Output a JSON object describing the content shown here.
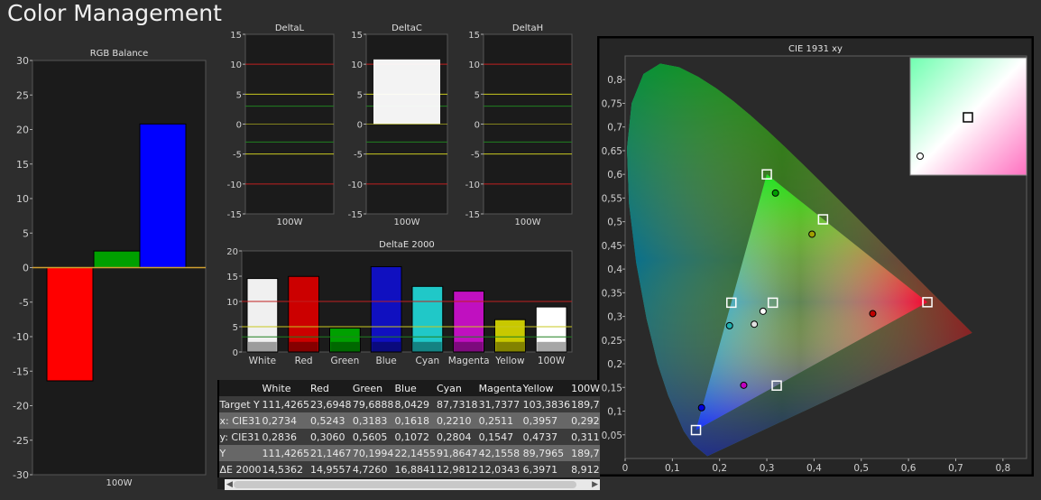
{
  "page": {
    "title": "Color Management"
  },
  "colors": {
    "red": "#ff0000",
    "green": "#00a000",
    "blue": "#0000ff",
    "white": "#f0f0f0",
    "cyan": "#20c8c8",
    "magenta": "#c000c0",
    "yellow": "#c8c800",
    "gray": "#888888"
  },
  "chart_data": [
    {
      "type": "bar",
      "title": "RGB Balance",
      "categories": [
        "100W"
      ],
      "series": [
        {
          "name": "Red",
          "values": [
            -16.4
          ]
        },
        {
          "name": "Green",
          "values": [
            2.4
          ]
        },
        {
          "name": "Blue",
          "values": [
            20.8
          ]
        }
      ],
      "ylim": [
        -30,
        30
      ],
      "yticks": [
        "30",
        "25",
        "20",
        "15",
        "10",
        "5",
        "0",
        "-5",
        "-10",
        "-15",
        "-20",
        "-25",
        "-30"
      ]
    },
    {
      "type": "bar",
      "title": "DeltaL",
      "categories": [
        "100W"
      ],
      "values": [
        0
      ],
      "ylim": [
        -15,
        15
      ],
      "yticks": [
        "15",
        "10",
        "5",
        "0",
        "-5",
        "-10",
        "-15"
      ]
    },
    {
      "type": "bar",
      "title": "DeltaC",
      "categories": [
        "100W"
      ],
      "values": [
        10.8
      ],
      "ylim": [
        -15,
        15
      ],
      "yticks": [
        "15",
        "10",
        "5",
        "0",
        "-5",
        "-10",
        "-15"
      ]
    },
    {
      "type": "bar",
      "title": "DeltaH",
      "categories": [
        "100W"
      ],
      "values": [
        0
      ],
      "ylim": [
        -15,
        15
      ],
      "yticks": [
        "15",
        "10",
        "5",
        "0",
        "-5",
        "-10",
        "-15"
      ]
    },
    {
      "type": "bar",
      "title": "DeltaE 2000",
      "categories": [
        "White",
        "Red",
        "Green",
        "Blue",
        "Cyan",
        "Magenta",
        "Yellow",
        "100W"
      ],
      "values": [
        14.5362,
        14.9557,
        4.726,
        16.8841,
        12.9812,
        12.0343,
        6.3971,
        8.912
      ],
      "ylim": [
        0,
        20
      ],
      "yticks": [
        "20",
        "15",
        "10",
        "5",
        "0"
      ]
    },
    {
      "type": "scatter",
      "title": "CIE 1931 xy",
      "xlim": [
        0,
        0.85
      ],
      "ylim": [
        0,
        0.85
      ],
      "xticks": [
        "0",
        "0,1",
        "0,2",
        "0,3",
        "0,4",
        "0,5",
        "0,6",
        "0,7",
        "0,8"
      ],
      "yticks": [
        "0,8",
        "0,75",
        "0,7",
        "0,65",
        "0,6",
        "0,55",
        "0,5",
        "0,45",
        "0,4",
        "0,35",
        "0,3",
        "0,25",
        "0,2",
        "0,15",
        "0,1",
        "0,05"
      ],
      "targets": [
        {
          "name": "Red",
          "x": 0.64,
          "y": 0.33
        },
        {
          "name": "Green",
          "x": 0.3,
          "y": 0.6
        },
        {
          "name": "Blue",
          "x": 0.15,
          "y": 0.06
        },
        {
          "name": "White",
          "x": 0.3127,
          "y": 0.329
        },
        {
          "name": "Cyan",
          "x": 0.225,
          "y": 0.329
        },
        {
          "name": "Magenta",
          "x": 0.321,
          "y": 0.154
        },
        {
          "name": "Yellow",
          "x": 0.419,
          "y": 0.505
        }
      ],
      "measured": [
        {
          "name": "White",
          "x": 0.2734,
          "y": 0.2836,
          "color": "#e0e0e0"
        },
        {
          "name": "Red",
          "x": 0.5243,
          "y": 0.306,
          "color": "#c00000"
        },
        {
          "name": "Green",
          "x": 0.3183,
          "y": 0.5605,
          "color": "#00a000"
        },
        {
          "name": "Blue",
          "x": 0.1618,
          "y": 0.1072,
          "color": "#0000e0"
        },
        {
          "name": "Cyan",
          "x": 0.221,
          "y": 0.2804,
          "color": "#20b0b0"
        },
        {
          "name": "Magenta",
          "x": 0.2511,
          "y": 0.1547,
          "color": "#c000c0"
        },
        {
          "name": "Yellow",
          "x": 0.3957,
          "y": 0.4737,
          "color": "#a0a000"
        },
        {
          "name": "100W",
          "x": 0.292,
          "y": 0.311,
          "color": "#ffffff"
        }
      ]
    }
  ],
  "table": {
    "columns": [
      "White",
      "Red",
      "Green",
      "Blue",
      "Cyan",
      "Magenta",
      "Yellow",
      "100W"
    ],
    "rows": [
      {
        "label": "Target Y",
        "cells": [
          "111,4265",
          "23,6948",
          "79,6888",
          "8,0429",
          "87,7318",
          "31,7377",
          "103,3836",
          "189,7"
        ]
      },
      {
        "label": "x: CIE31",
        "cells": [
          "0,2734",
          "0,5243",
          "0,3183",
          "0,1618",
          "0,2210",
          "0,2511",
          "0,3957",
          "0,292"
        ]
      },
      {
        "label": "y: CIE31",
        "cells": [
          "0,2836",
          "0,3060",
          "0,5605",
          "0,1072",
          "0,2804",
          "0,1547",
          "0,4737",
          "0,311"
        ]
      },
      {
        "label": "Y",
        "cells": [
          "111,4265",
          "21,1467",
          "70,1994",
          "22,1455",
          "91,8647",
          "42,1558",
          "89,7965",
          "189,7"
        ]
      },
      {
        "label": "ΔE 2000",
        "cells": [
          "14,5362",
          "14,9557",
          "4,7260",
          "16,8841",
          "12,9812",
          "12,0343",
          "6,3971",
          "8,912"
        ]
      }
    ]
  }
}
